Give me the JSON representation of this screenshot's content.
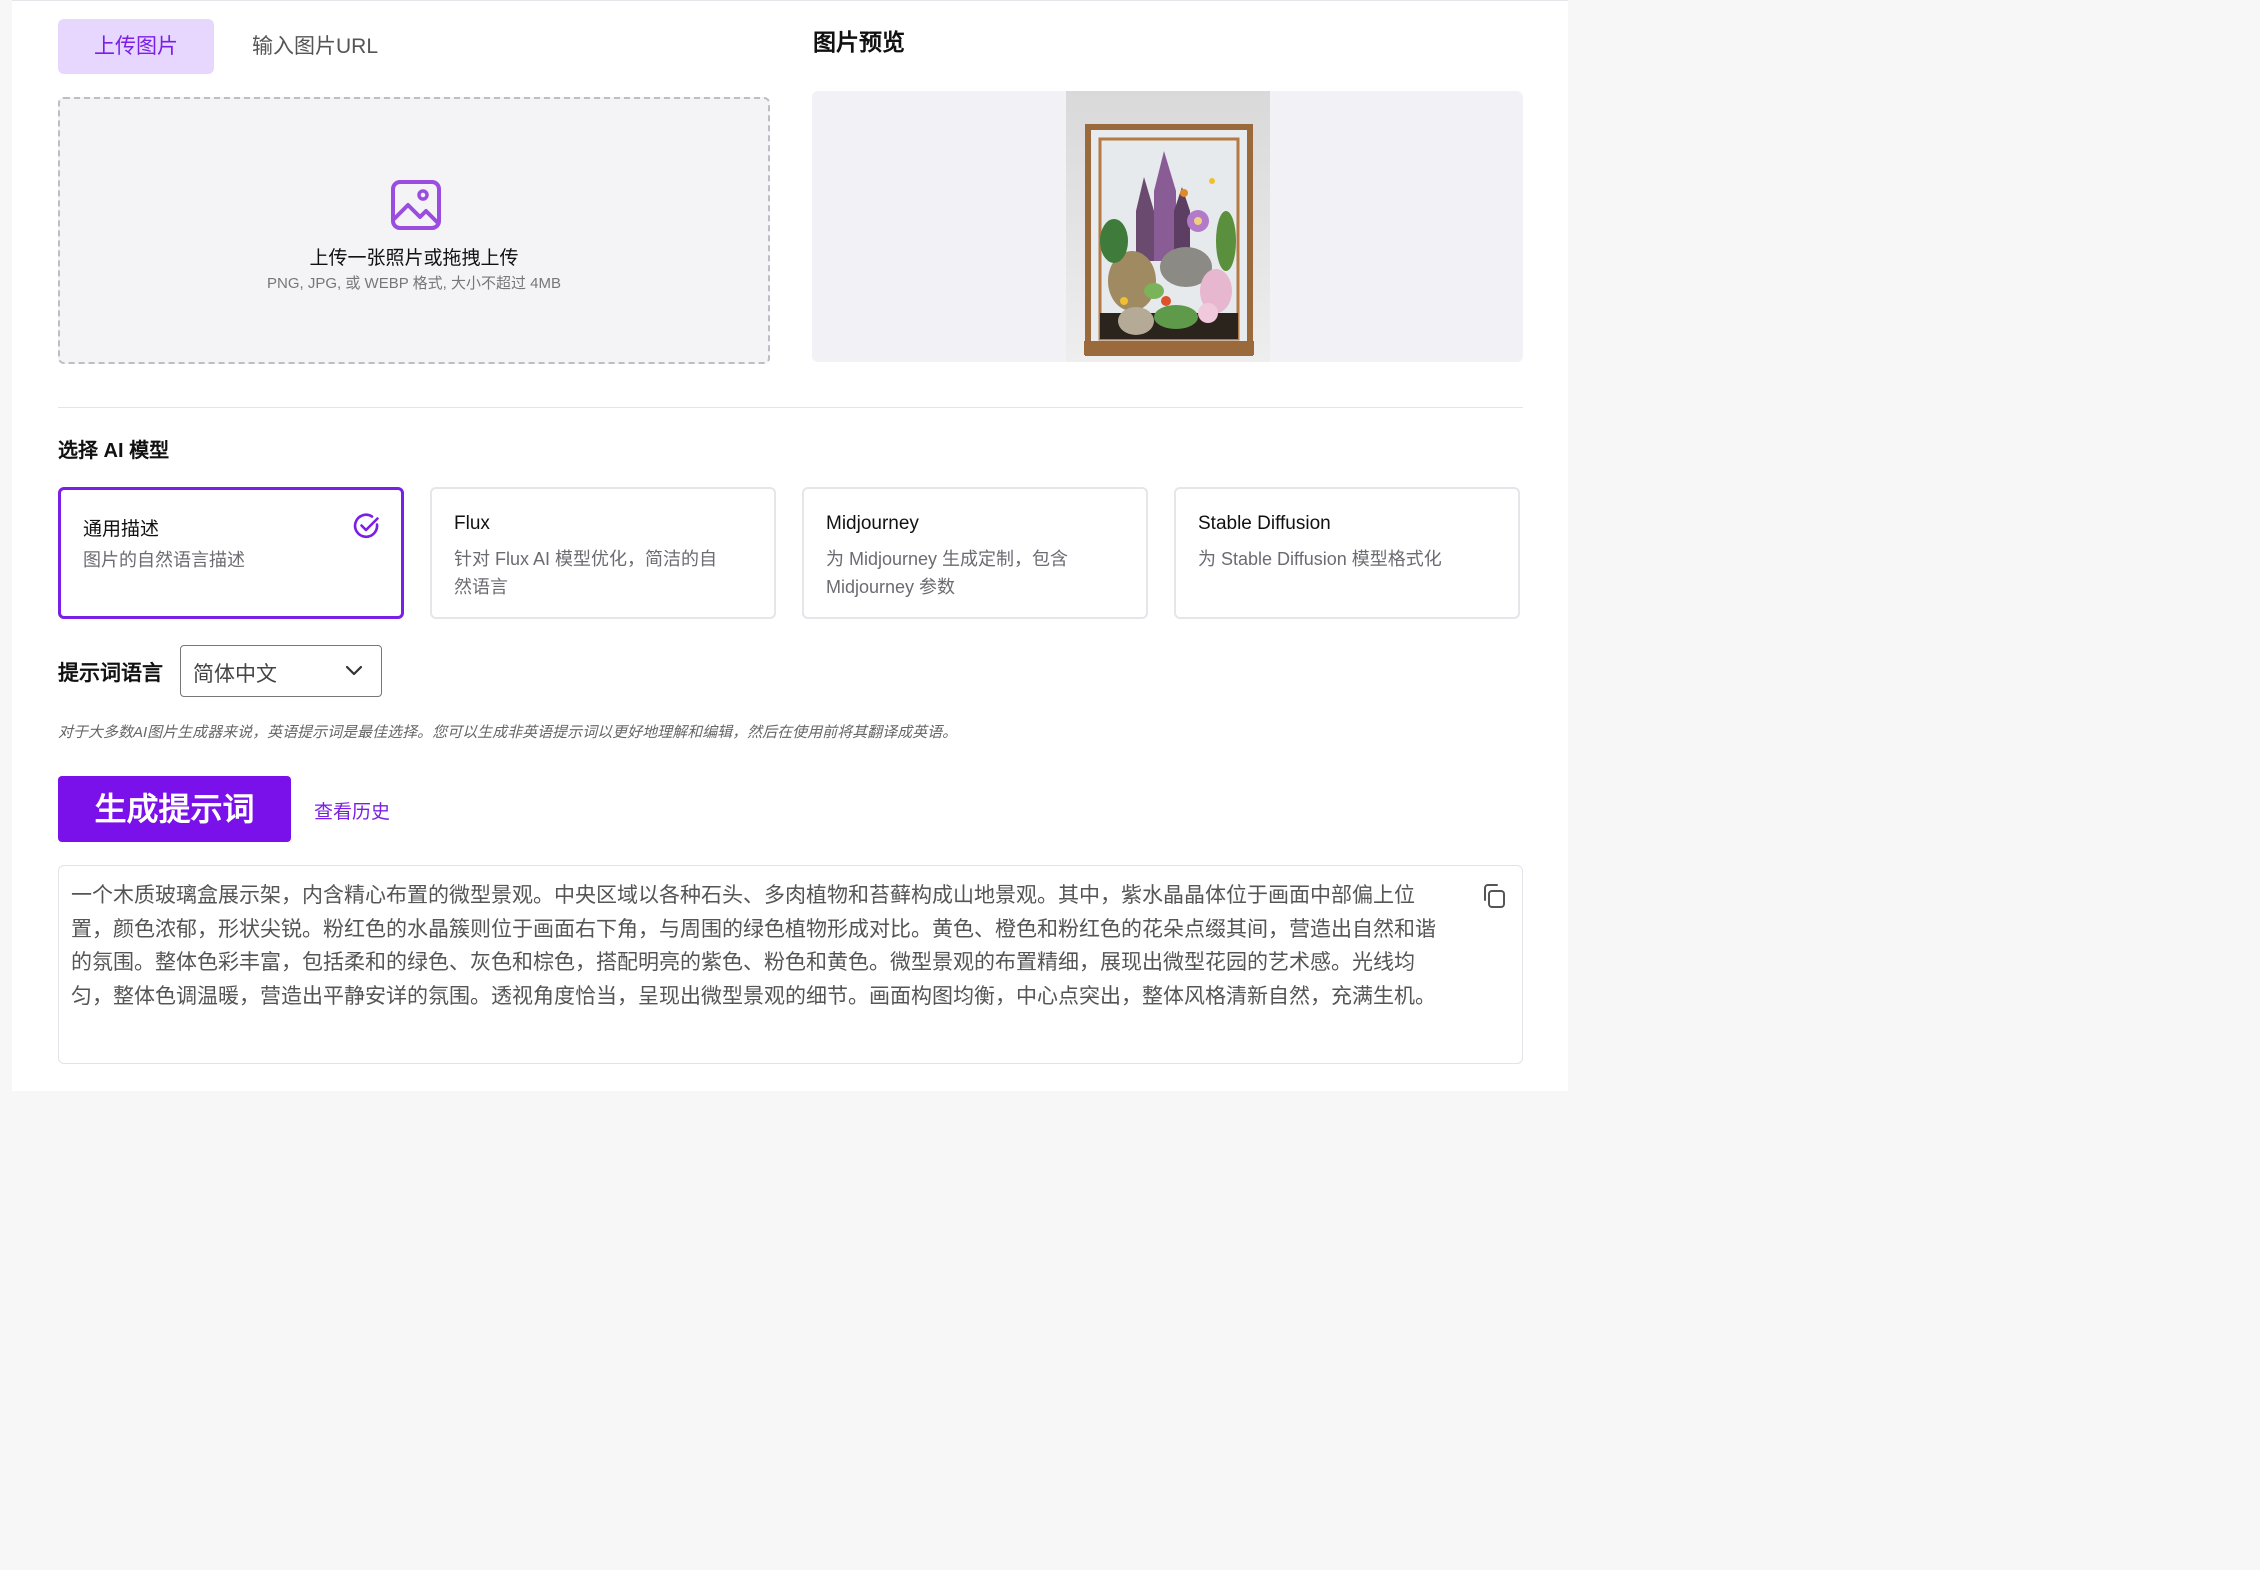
{
  "tabs": {
    "upload_label": "上传图片",
    "url_label": "输入图片URL"
  },
  "preview": {
    "title": "图片预览"
  },
  "upload": {
    "main_text": "上传一张照片或拖拽上传",
    "sub_text": "PNG, JPG, 或 WEBP 格式, 大小不超过 4MB",
    "icon": "image-upload-icon"
  },
  "models": {
    "section_title": "选择 AI 模型",
    "items": [
      {
        "title": "通用描述",
        "desc": "图片的自然语言描述",
        "selected": true
      },
      {
        "title": "Flux",
        "desc": "针对 Flux AI 模型优化，简洁的自然语言",
        "selected": false
      },
      {
        "title": "Midjourney",
        "desc": "为 Midjourney 生成定制，包含 Midjourney 参数",
        "selected": false
      },
      {
        "title": "Stable Diffusion",
        "desc": "为 Stable Diffusion 模型格式化",
        "selected": false
      }
    ]
  },
  "language": {
    "label": "提示词语言",
    "value": "简体中文"
  },
  "hint": "对于大多数AI图片生成器来说，英语提示词是最佳选择。您可以生成非英语提示词以更好地理解和编辑，然后在使用前将其翻译成英语。",
  "actions": {
    "generate_label": "生成提示词",
    "history_label": "查看历史"
  },
  "result": {
    "text": "一个木质玻璃盒展示架，内含精心布置的微型景观。中央区域以各种石头、多肉植物和苔藓构成山地景观。其中，紫水晶晶体位于画面中部偏上位置，颜色浓郁，形状尖锐。粉红色的水晶簇则位于画面右下角，与周围的绿色植物形成对比。黄色、橙色和粉红色的花朵点缀其间，营造出自然和谐的氛围。整体色彩丰富，包括柔和的绿色、灰色和棕色，搭配明亮的紫色、粉色和黄色。微型景观的布置精细，展现出微型花园的艺术感。光线均匀，整体色调温暖，营造出平静安详的氛围。透视角度恰当，呈现出微型景观的细节。画面构图均衡，中心点突出，整体风格清新自然，充满生机。"
  },
  "colors": {
    "accent": "#7a10ea",
    "accent_light": "#e7d7ff"
  }
}
